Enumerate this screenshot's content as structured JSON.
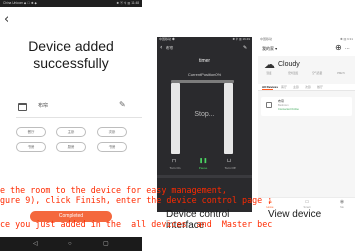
{
  "phone1": {
    "status_left": "China Unicom ◆ ☐ ✱ ◆",
    "status_right": "✱ ⓝ ⚲ ▥ 11:48",
    "back_icon": "‹",
    "title": "Device added\nsuccessfully",
    "device_name": "布帘",
    "room_chips": [
      "餐厅",
      "主卧",
      "次卧",
      "书房",
      "厨房",
      "书房"
    ],
    "completed_label": "Completed",
    "nav": {
      "back": "◁",
      "home": "○",
      "recent": "▢"
    }
  },
  "phone2": {
    "status_left": "中国移动 ◆",
    "status_right": "✱ ⚲ ▥ 16:49",
    "back_icon": "‹",
    "title": "布帘",
    "edit_icon": "✎",
    "device_name": "timer",
    "position_label": "CurrentPosition0%",
    "state": "Stop...",
    "controls": [
      {
        "icon": "⊓",
        "label": "Turn On"
      },
      {
        "icon": "❚❚",
        "label": "Pause"
      },
      {
        "icon": "⊔",
        "label": "Turn Off"
      }
    ]
  },
  "phone3": {
    "status_left": "中国移动",
    "status_right": "✱ ▥ 9:31",
    "home_title": "我的家 ▾",
    "add_icon": "⊕",
    "menu_icon": "⋯",
    "weather_icon": "☁",
    "weather": "Cloudy",
    "stats": [
      "湿度",
      "室外温度",
      "空气质量",
      "PM2.5"
    ],
    "tabs": [
      "All Devices",
      "客厅",
      "主卧",
      "次卧",
      "餐厅"
    ],
    "device_card": {
      "name": "布帘",
      "room": "Bedroom",
      "status": "Connected Online"
    },
    "bottom_nav": [
      {
        "icon": "⌂",
        "label": "Home"
      },
      {
        "icon": "▭",
        "label": "Smart"
      },
      {
        "icon": "◉",
        "label": "Me"
      }
    ]
  },
  "overlay_text": {
    "line1": "e the room to the device for easy management,",
    "line2": "gure 9), click Finish, enter the device control page ;",
    "line3": "ce you just added in the  all devices  and  Master bec"
  },
  "captions": {
    "control": "Device control\ninterface",
    "view": "View device"
  },
  "colors": {
    "accent_orange": "#f4683d",
    "overlay_red": "#ff2a00",
    "dark_panel": "#2a2a2d"
  }
}
